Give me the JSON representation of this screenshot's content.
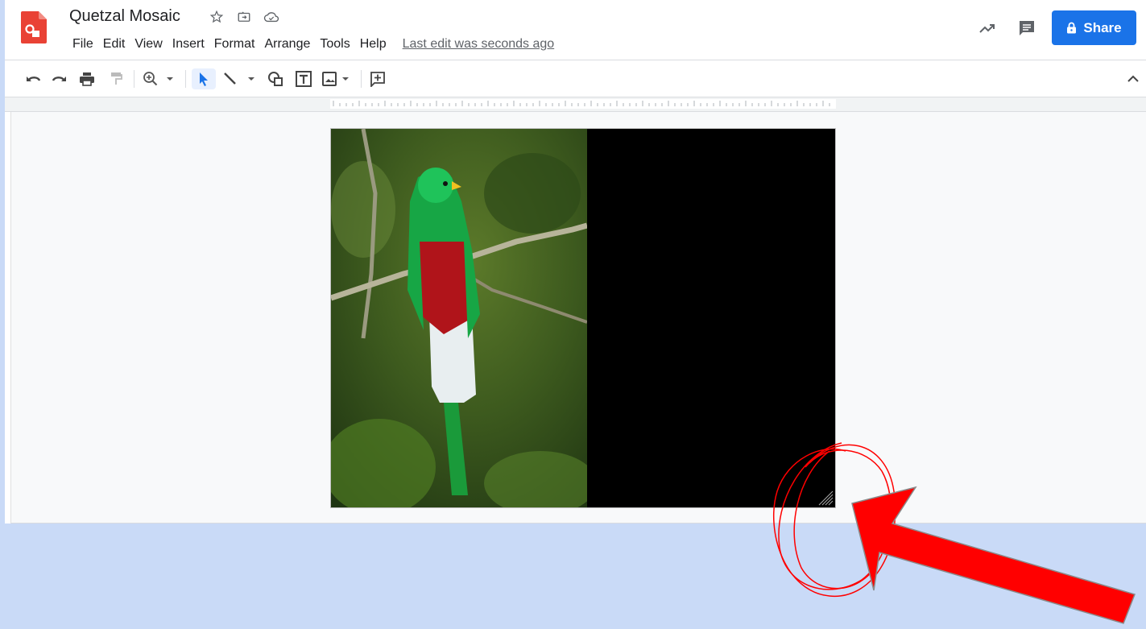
{
  "header": {
    "doc_title": "Quetzal Mosaic",
    "menu": [
      "File",
      "Edit",
      "View",
      "Insert",
      "Format",
      "Arrange",
      "Tools",
      "Help"
    ],
    "last_edit": "Last edit was seconds ago",
    "share_label": "Share"
  },
  "icons": {
    "star": "star-icon",
    "move": "move-to-folder-icon",
    "cloud": "cloud-saved-icon",
    "activity": "activity-trend-icon",
    "comments": "comments-icon",
    "lock": "lock-icon"
  },
  "toolbar": {
    "tools": [
      "undo",
      "redo",
      "print",
      "paint-format",
      "zoom",
      "select",
      "line",
      "shape",
      "text-box",
      "image",
      "comment",
      "collapse"
    ]
  },
  "colors": {
    "accent": "#1a73e8",
    "annotation": "#ff0000",
    "page_bg": "#c9daf7"
  }
}
